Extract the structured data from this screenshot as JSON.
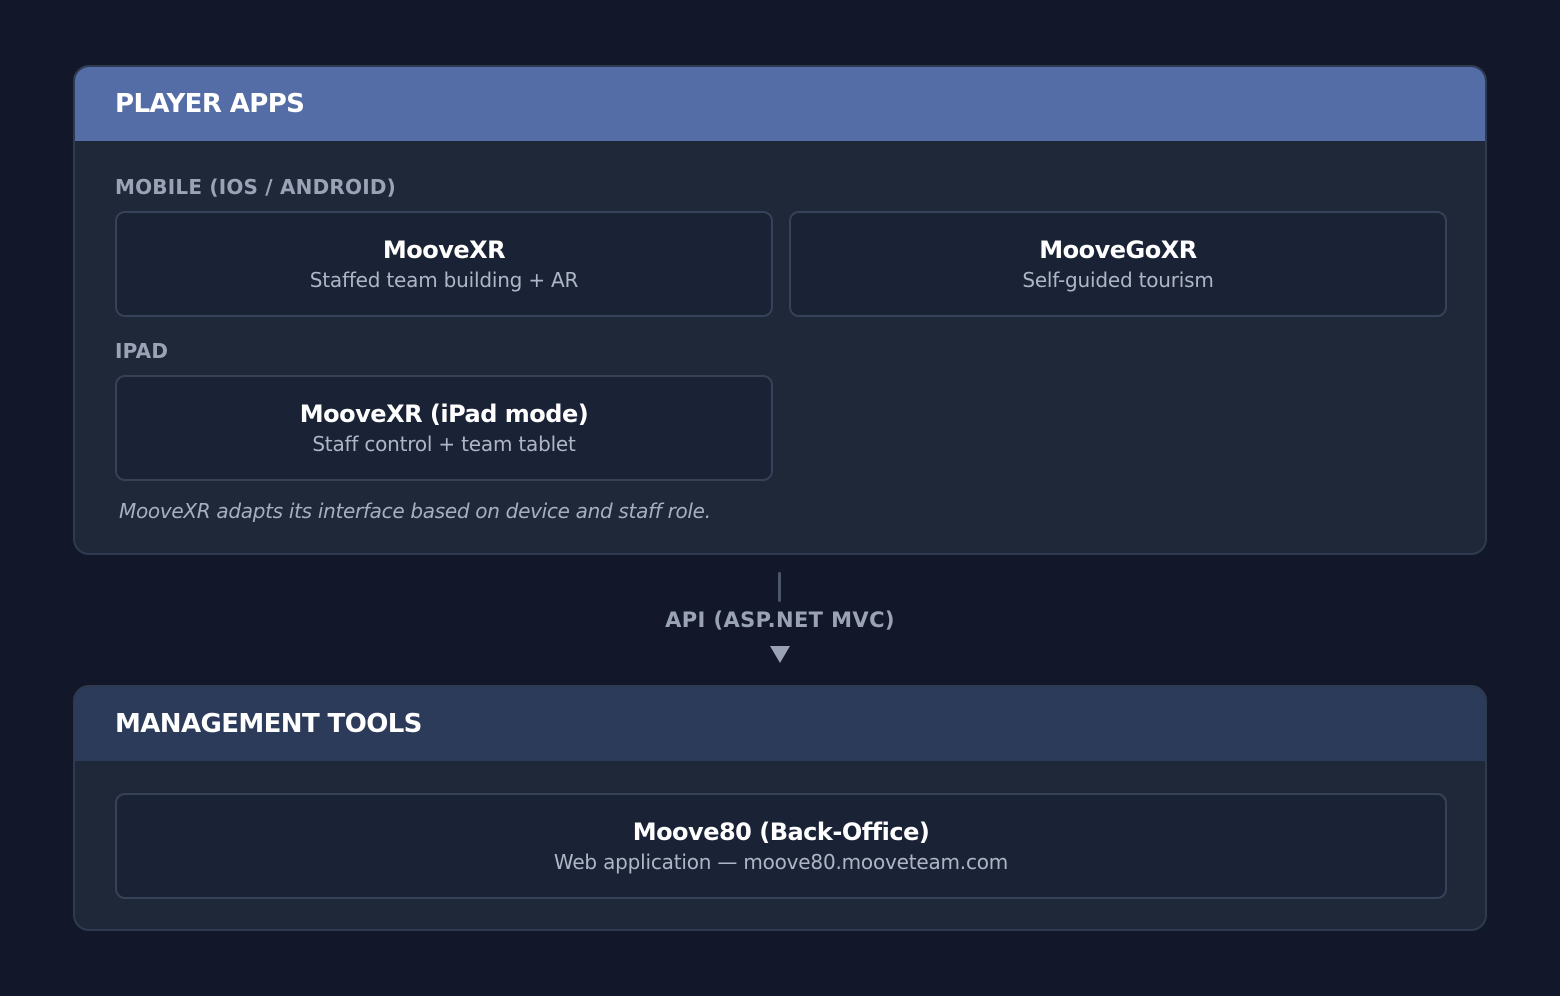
{
  "player_apps": {
    "title": "PLAYER APPS",
    "mobile_label": "MOBILE (IOS / ANDROID)",
    "cards": [
      {
        "title": "MooveXR",
        "subtitle": "Staffed team building + AR"
      },
      {
        "title": "MooveGoXR",
        "subtitle": "Self-guided tourism"
      }
    ],
    "ipad_label": "IPAD",
    "ipad_card": {
      "title": "MooveXR (iPad mode)",
      "subtitle": "Staff control + team tablet"
    },
    "note": "MooveXR adapts its interface based on device and staff role."
  },
  "connector": {
    "label": "API (ASP.NET MVC)"
  },
  "management_tools": {
    "title": "MANAGEMENT TOOLS",
    "card": {
      "title": "Moove80 (Back-Office)",
      "subtitle": "Web application — moove80.mooveteam.com"
    }
  },
  "colors": {
    "background": "#121829",
    "player_header": "#546da6",
    "management_header": "#2d3b5b",
    "panel_body": "#1f2839",
    "card": "#1a2235"
  }
}
